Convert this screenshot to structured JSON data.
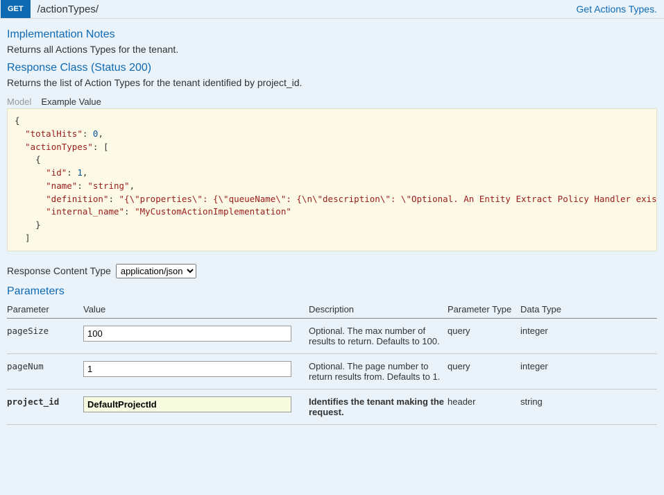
{
  "header": {
    "method": "GET",
    "path": "/actionTypes/",
    "summary": "Get Actions Types."
  },
  "implementation": {
    "heading": "Implementation Notes",
    "text": "Returns all Actions Types for the tenant."
  },
  "response_class": {
    "heading": "Response Class (Status 200)",
    "text": "Returns the list of Action Types for the tenant identified by project_id."
  },
  "tabs": {
    "model": "Model",
    "example": "Example Value"
  },
  "response_content_type": {
    "label": "Response Content Type",
    "value": "application/json"
  },
  "parameters_heading": "Parameters",
  "table_headers": {
    "parameter": "Parameter",
    "value": "Value",
    "description": "Description",
    "param_type": "Parameter Type",
    "data_type": "Data Type"
  },
  "parameters": [
    {
      "name": "pageSize",
      "value": "100",
      "description": "Optional. The max number of results to return. Defaults to 100.",
      "param_type": "query",
      "data_type": "integer",
      "required": false
    },
    {
      "name": "pageNum",
      "value": "1",
      "description": "Optional. The page number to return results from. Defaults to 1.",
      "param_type": "query",
      "data_type": "integer",
      "required": false
    },
    {
      "name": "project_id",
      "value": "DefaultProjectId",
      "description": "Identifies the tenant making the request.",
      "param_type": "header",
      "data_type": "string",
      "required": true
    }
  ]
}
